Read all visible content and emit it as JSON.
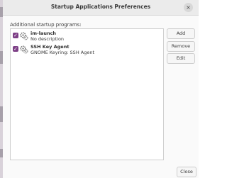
{
  "window": {
    "title": "Startup Applications Preferences",
    "close_glyph": "×"
  },
  "main": {
    "section_label": "Additional startup programs:",
    "programs": [
      {
        "name": "im-launch",
        "description": "No description",
        "enabled": true,
        "icon": "gears-icon"
      },
      {
        "name": "SSH Key Agent",
        "description": "GNOME Keyring: SSH Agent",
        "enabled": true,
        "icon": "gears-icon"
      }
    ]
  },
  "buttons": {
    "add": "Add",
    "remove": "Remove",
    "edit": "Edit",
    "close": "Close"
  },
  "colors": {
    "checkbox_accent": "#7d3f86",
    "titlebar": "#ebebeb",
    "window_bg": "#fafafa"
  }
}
